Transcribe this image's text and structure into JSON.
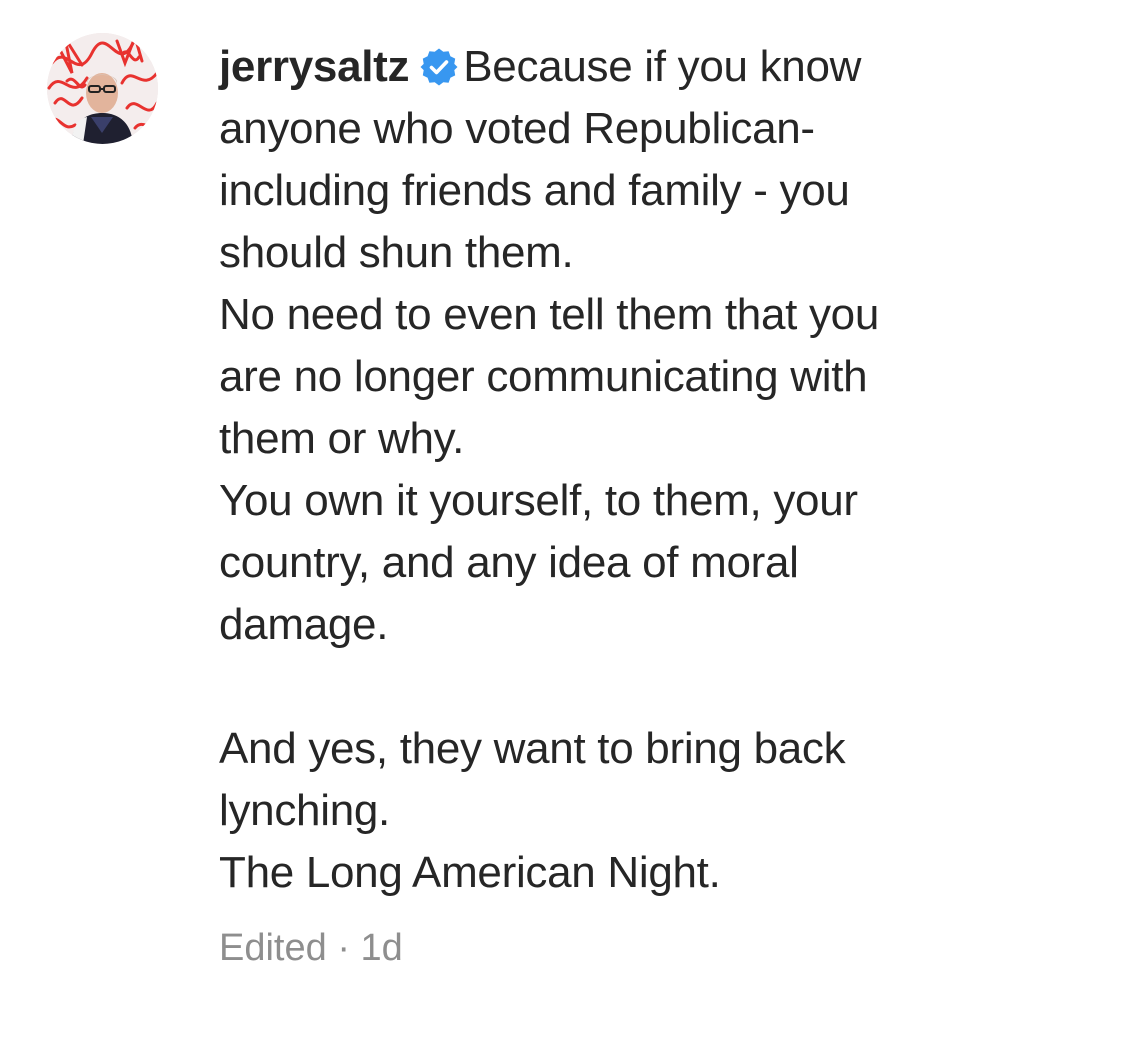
{
  "comment": {
    "username": "jerrysaltz",
    "verified_icon": "verified-badge-icon",
    "avatar_icon": "profile-avatar",
    "lines": [
      "Because if you know",
      "anyone who voted Republican-",
      "including friends and family - you",
      "should shun them.",
      "No need to even tell them that you",
      "are no longer communicating with",
      "them or why.",
      "You own it yourself, to them, your",
      "country, and any idea of moral",
      "damage.",
      "",
      "And yes, they want to bring back",
      "lynching.",
      "The Long American Night."
    ],
    "edited_label": "Edited",
    "separator": "·",
    "timestamp": "1d"
  },
  "colors": {
    "text": "#262626",
    "meta": "#8e8e8e",
    "verified": "#3897f0",
    "avatar_accent": "#e8322f"
  }
}
